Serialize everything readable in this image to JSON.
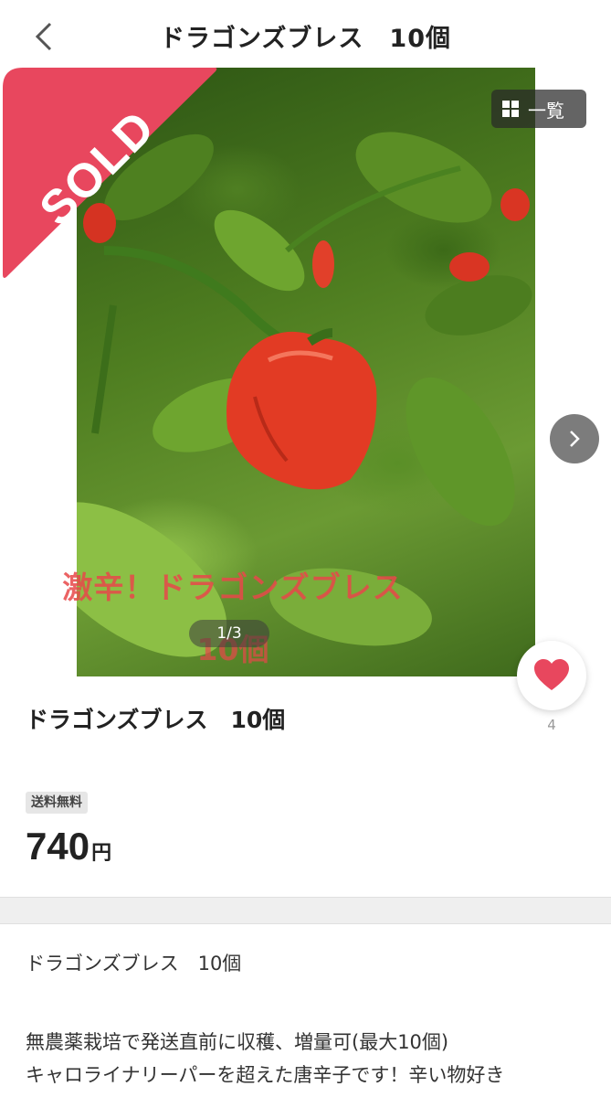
{
  "header": {
    "title": "ドラゴンズブレス　10個"
  },
  "gallery": {
    "overlay_line1": "激辛！ドラゴンズブレス",
    "overlay_line2": "10個",
    "page_indicator": "1/3",
    "list_button_label": "一覧",
    "sold_label": "SOLD"
  },
  "item": {
    "title": "ドラゴンズブレス　10個",
    "likes": "4",
    "shipping_badge": "送料無料",
    "price": "740",
    "price_unit": "円"
  },
  "description": {
    "title": "ドラゴンズブレス　10個",
    "line1": "無農薬栽培で発送直前に収穫、増量可(最大10個)",
    "line2": "キャロライナリーパーを超えた唐辛子です！辛い物好き"
  },
  "colors": {
    "sold_red": "#e8475e",
    "like_red": "#e8475e"
  },
  "icons": [
    "back-arrow-icon",
    "grid-icon",
    "chevron-right-icon",
    "heart-icon"
  ]
}
